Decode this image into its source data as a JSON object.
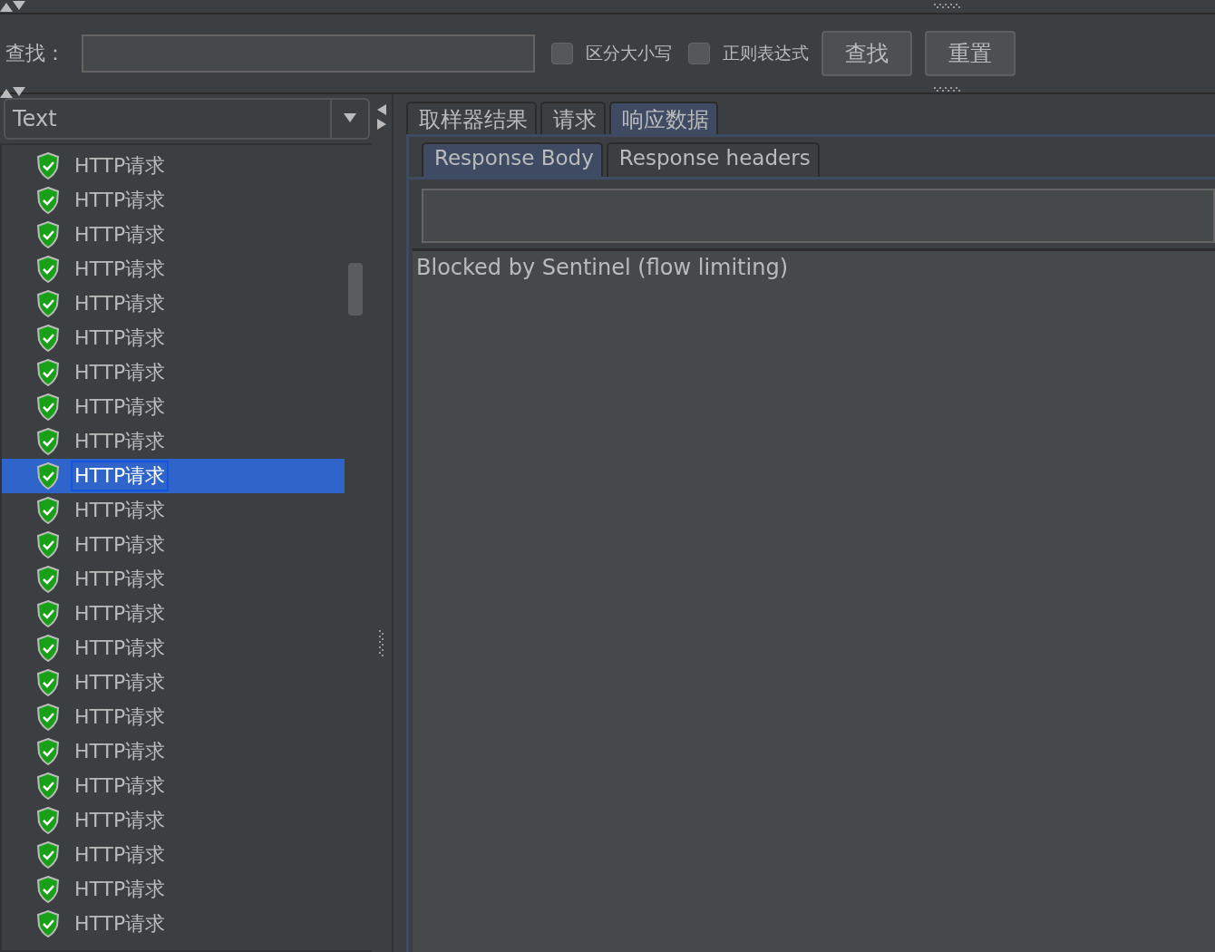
{
  "search": {
    "label": "查找：",
    "options": [
      {
        "label": "区分大小写",
        "checked": false
      },
      {
        "label": "正则表达式",
        "checked": false
      }
    ],
    "buttons": [
      "查找",
      "重置"
    ]
  },
  "renderer": {
    "value": "Text"
  },
  "results": [
    {
      "label": "HTTP请求",
      "selected": false
    },
    {
      "label": "HTTP请求",
      "selected": false
    },
    {
      "label": "HTTP请求",
      "selected": false
    },
    {
      "label": "HTTP请求",
      "selected": false
    },
    {
      "label": "HTTP请求",
      "selected": false
    },
    {
      "label": "HTTP请求",
      "selected": false
    },
    {
      "label": "HTTP请求",
      "selected": false
    },
    {
      "label": "HTTP请求",
      "selected": false
    },
    {
      "label": "HTTP请求",
      "selected": false
    },
    {
      "label": "HTTP请求",
      "selected": true
    },
    {
      "label": "HTTP请求",
      "selected": false
    },
    {
      "label": "HTTP请求",
      "selected": false
    },
    {
      "label": "HTTP请求",
      "selected": false
    },
    {
      "label": "HTTP请求",
      "selected": false
    },
    {
      "label": "HTTP请求",
      "selected": false
    },
    {
      "label": "HTTP请求",
      "selected": false
    },
    {
      "label": "HTTP请求",
      "selected": false
    },
    {
      "label": "HTTP请求",
      "selected": false
    },
    {
      "label": "HTTP请求",
      "selected": false
    },
    {
      "label": "HTTP请求",
      "selected": false
    },
    {
      "label": "HTTP请求",
      "selected": false
    },
    {
      "label": "HTTP请求",
      "selected": false
    },
    {
      "label": "HTTP请求",
      "selected": false
    }
  ],
  "tabs": [
    {
      "label": "取样器结果",
      "selected": false
    },
    {
      "label": "请求",
      "selected": false
    },
    {
      "label": "响应数据",
      "selected": true
    }
  ],
  "subtabs": [
    {
      "label": "Response Body",
      "selected": true
    },
    {
      "label": "Response headers",
      "selected": false
    }
  ],
  "response_body": "Blocked by Sentinel (flow limiting)"
}
